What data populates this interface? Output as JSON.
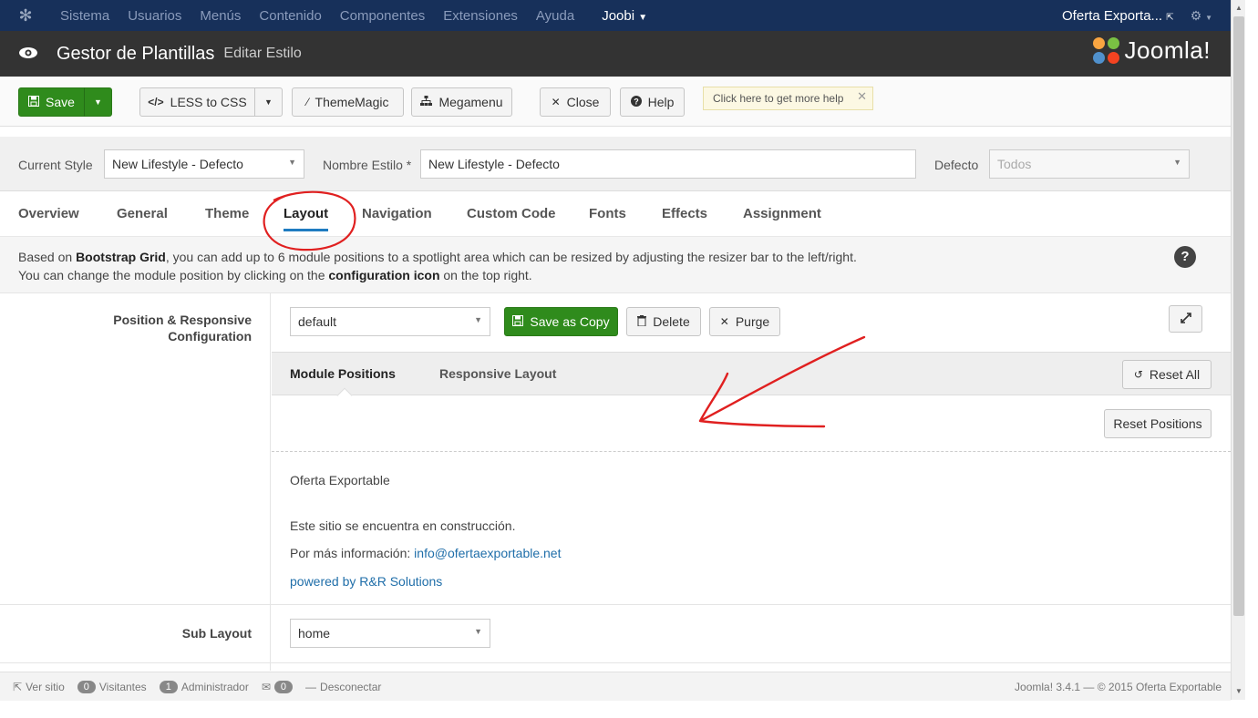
{
  "topnav": {
    "items": [
      "Sistema",
      "Usuarios",
      "Menús",
      "Contenido",
      "Componentes",
      "Extensiones",
      "Ayuda"
    ],
    "joobi": "Joobi",
    "site": "Oferta Exporta..."
  },
  "header": {
    "title": "Gestor de Plantillas",
    "subtitle": "Editar Estilo",
    "logo": "Joomla!"
  },
  "toolbar": {
    "save": "Save",
    "less": "LESS to CSS",
    "thememagic": "ThemeMagic",
    "megamenu": "Megamenu",
    "close": "Close",
    "help": "Help",
    "tooltip": "Click here to get more help"
  },
  "stylebar": {
    "current_label": "Current Style",
    "current_value": "New Lifestyle - Defecto",
    "name_label": "Nombre Estilo *",
    "name_value": "New Lifestyle - Defecto",
    "default_label": "Defecto",
    "default_value": "Todos"
  },
  "tabs": [
    "Overview",
    "General",
    "Theme",
    "Layout",
    "Navigation",
    "Custom Code",
    "Fonts",
    "Effects",
    "Assignment"
  ],
  "info": {
    "p1a": "Based on ",
    "p1b": "Bootstrap Grid",
    "p1c": ", you can add up to 6 module positions to a spotlight area which can be resized by adjusting the resizer bar to the left/right.",
    "p2a": "You can change the module position by clicking on the ",
    "p2b": "configuration icon",
    "p2c": " on the top right."
  },
  "layout": {
    "pos_label_1": "Position & Responsive",
    "pos_label_2": "Configuration",
    "layout_value": "default",
    "save_copy": "Save as Copy",
    "delete": "Delete",
    "purge": "Purge",
    "subtab_module": "Module Positions",
    "subtab_responsive": "Responsive Layout",
    "reset_all": "Reset All",
    "reset_positions": "Reset Positions",
    "sub_layout_label": "Sub Layout",
    "sub_layout_value": "home"
  },
  "preview": {
    "line1": "Oferta Exportable",
    "line2": "Este sitio se encuentra en construcción.",
    "line3": "Por más información: ",
    "email": "info@ofertaexportable.net",
    "powered": "powered by R&R Solutions"
  },
  "footer": {
    "view_site": "Ver sitio",
    "visitors_count": "0",
    "visitors": "Visitantes",
    "admin_count": "1",
    "admin": "Administrador",
    "msg_count": "0",
    "logout": "Desconectar",
    "right": "Joomla! 3.4.1 — © 2015 Oferta Exportable"
  },
  "colors": {
    "topnav": "#17305a",
    "header": "#333333",
    "save_green": "#2f8b1c",
    "annotation_red": "#e02020",
    "active_tab_underline": "#1f7cc1"
  }
}
